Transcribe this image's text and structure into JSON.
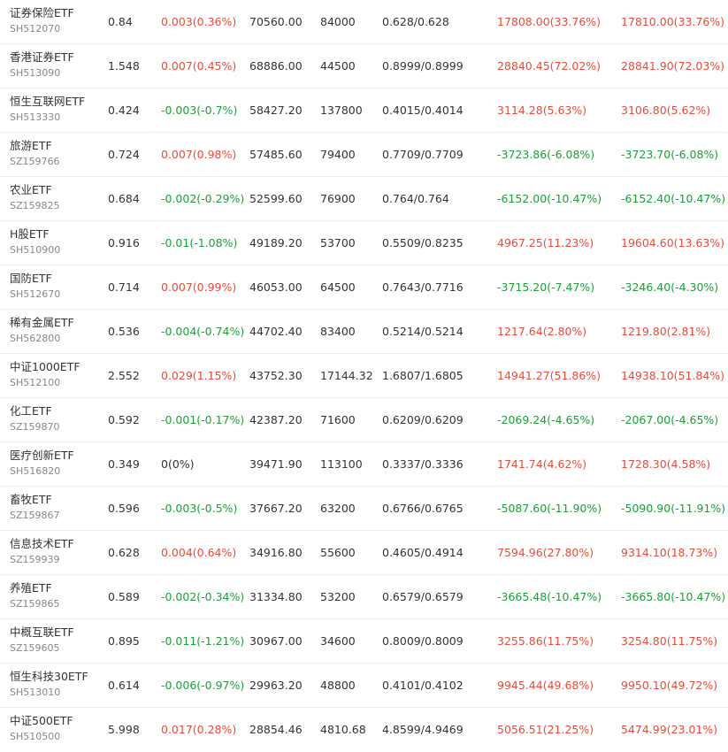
{
  "colors": {
    "up": "#e74c3c",
    "down": "#1e9e3a",
    "flat": "#333333"
  },
  "rows": [
    {
      "name": "证券保险ETF",
      "code": "SH512070",
      "price": "0.84",
      "change": "0.003(0.36%)",
      "change_dir": "up",
      "market_value": "70560.00",
      "shares": "84000",
      "cost": "0.628/0.628",
      "pnl1": "17808.00(33.76%)",
      "pnl1_dir": "up",
      "pnl2": "17810.00(33.76%)",
      "pnl2_dir": "up"
    },
    {
      "name": "香港证券ETF",
      "code": "SH513090",
      "price": "1.548",
      "change": "0.007(0.45%)",
      "change_dir": "up",
      "market_value": "68886.00",
      "shares": "44500",
      "cost": "0.8999/0.8999",
      "pnl1": "28840.45(72.02%)",
      "pnl1_dir": "up",
      "pnl2": "28841.90(72.03%)",
      "pnl2_dir": "up"
    },
    {
      "name": "恒生互联网ETF",
      "code": "SH513330",
      "price": "0.424",
      "change": "-0.003(-0.7%)",
      "change_dir": "down",
      "market_value": "58427.20",
      "shares": "137800",
      "cost": "0.4015/0.4014",
      "pnl1": "3114.28(5.63%)",
      "pnl1_dir": "up",
      "pnl2": "3106.80(5.62%)",
      "pnl2_dir": "up"
    },
    {
      "name": "旅游ETF",
      "code": "SZ159766",
      "price": "0.724",
      "change": "0.007(0.98%)",
      "change_dir": "up",
      "market_value": "57485.60",
      "shares": "79400",
      "cost": "0.7709/0.7709",
      "pnl1": "-3723.86(-6.08%)",
      "pnl1_dir": "down",
      "pnl2": "-3723.70(-6.08%)",
      "pnl2_dir": "down"
    },
    {
      "name": "农业ETF",
      "code": "SZ159825",
      "price": "0.684",
      "change": "-0.002(-0.29%)",
      "change_dir": "down",
      "market_value": "52599.60",
      "shares": "76900",
      "cost": "0.764/0.764",
      "pnl1": "-6152.00(-10.47%)",
      "pnl1_dir": "down",
      "pnl2": "-6152.40(-10.47%)",
      "pnl2_dir": "down"
    },
    {
      "name": "H股ETF",
      "code": "SH510900",
      "price": "0.916",
      "change": "-0.01(-1.08%)",
      "change_dir": "down",
      "market_value": "49189.20",
      "shares": "53700",
      "cost": "0.5509/0.8235",
      "pnl1": "4967.25(11.23%)",
      "pnl1_dir": "up",
      "pnl2": "19604.60(13.63%)",
      "pnl2_dir": "up"
    },
    {
      "name": "国防ETF",
      "code": "SH512670",
      "price": "0.714",
      "change": "0.007(0.99%)",
      "change_dir": "up",
      "market_value": "46053.00",
      "shares": "64500",
      "cost": "0.7643/0.7716",
      "pnl1": "-3715.20(-7.47%)",
      "pnl1_dir": "down",
      "pnl2": "-3246.40(-4.30%)",
      "pnl2_dir": "down"
    },
    {
      "name": "稀有金属ETF",
      "code": "SH562800",
      "price": "0.536",
      "change": "-0.004(-0.74%)",
      "change_dir": "down",
      "market_value": "44702.40",
      "shares": "83400",
      "cost": "0.5214/0.5214",
      "pnl1": "1217.64(2.80%)",
      "pnl1_dir": "up",
      "pnl2": "1219.80(2.81%)",
      "pnl2_dir": "up"
    },
    {
      "name": "中证1000ETF",
      "code": "SH512100",
      "price": "2.552",
      "change": "0.029(1.15%)",
      "change_dir": "up",
      "market_value": "43752.30",
      "shares": "17144.32",
      "cost": "1.6807/1.6805",
      "pnl1": "14941.27(51.86%)",
      "pnl1_dir": "up",
      "pnl2": "14938.10(51.84%)",
      "pnl2_dir": "up"
    },
    {
      "name": "化工ETF",
      "code": "SZ159870",
      "price": "0.592",
      "change": "-0.001(-0.17%)",
      "change_dir": "down",
      "market_value": "42387.20",
      "shares": "71600",
      "cost": "0.6209/0.6209",
      "pnl1": "-2069.24(-4.65%)",
      "pnl1_dir": "down",
      "pnl2": "-2067.00(-4.65%)",
      "pnl2_dir": "down"
    },
    {
      "name": "医疗创新ETF",
      "code": "SH516820",
      "price": "0.349",
      "change": "0(0%)",
      "change_dir": "flat",
      "market_value": "39471.90",
      "shares": "113100",
      "cost": "0.3337/0.3336",
      "pnl1": "1741.74(4.62%)",
      "pnl1_dir": "up",
      "pnl2": "1728.30(4.58%)",
      "pnl2_dir": "up"
    },
    {
      "name": "畜牧ETF",
      "code": "SZ159867",
      "price": "0.596",
      "change": "-0.003(-0.5%)",
      "change_dir": "down",
      "market_value": "37667.20",
      "shares": "63200",
      "cost": "0.6766/0.6765",
      "pnl1": "-5087.60(-11.90%)",
      "pnl1_dir": "down",
      "pnl2": "-5090.90(-11.91%)",
      "pnl2_dir": "down"
    },
    {
      "name": "信息技术ETF",
      "code": "SZ159939",
      "price": "0.628",
      "change": "0.004(0.64%)",
      "change_dir": "up",
      "market_value": "34916.80",
      "shares": "55600",
      "cost": "0.4605/0.4914",
      "pnl1": "7594.96(27.80%)",
      "pnl1_dir": "up",
      "pnl2": "9314.10(18.73%)",
      "pnl2_dir": "up"
    },
    {
      "name": "养殖ETF",
      "code": "SZ159865",
      "price": "0.589",
      "change": "-0.002(-0.34%)",
      "change_dir": "down",
      "market_value": "31334.80",
      "shares": "53200",
      "cost": "0.6579/0.6579",
      "pnl1": "-3665.48(-10.47%)",
      "pnl1_dir": "down",
      "pnl2": "-3665.80(-10.47%)",
      "pnl2_dir": "down"
    },
    {
      "name": "中概互联ETF",
      "code": "SZ159605",
      "price": "0.895",
      "change": "-0.011(-1.21%)",
      "change_dir": "down",
      "market_value": "30967.00",
      "shares": "34600",
      "cost": "0.8009/0.8009",
      "pnl1": "3255.86(11.75%)",
      "pnl1_dir": "up",
      "pnl2": "3254.80(11.75%)",
      "pnl2_dir": "up"
    },
    {
      "name": "恒生科技30ETF",
      "code": "SH513010",
      "price": "0.614",
      "change": "-0.006(-0.97%)",
      "change_dir": "down",
      "market_value": "29963.20",
      "shares": "48800",
      "cost": "0.4101/0.4102",
      "pnl1": "9945.44(49.68%)",
      "pnl1_dir": "up",
      "pnl2": "9950.10(49.72%)",
      "pnl2_dir": "up"
    },
    {
      "name": "中证500ETF",
      "code": "SH510500",
      "price": "5.998",
      "change": "0.017(0.28%)",
      "change_dir": "up",
      "market_value": "28854.46",
      "shares": "4810.68",
      "cost": "4.8599/4.9469",
      "pnl1": "5056.51(21.25%)",
      "pnl1_dir": "up",
      "pnl2": "5474.99(23.01%)",
      "pnl2_dir": "up"
    }
  ]
}
